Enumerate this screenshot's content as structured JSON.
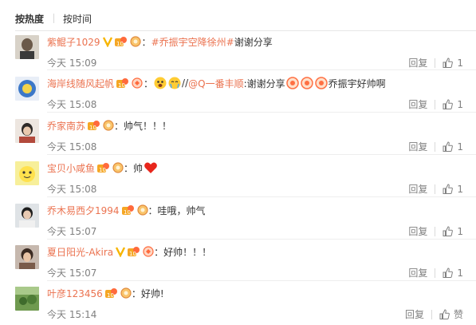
{
  "sort": {
    "hot": "按热度",
    "time": "按时间"
  },
  "reply_label": "回复",
  "comments": [
    {
      "user": "紫鲲子1029",
      "parts": [
        {
          "t": "topic",
          "v": "#乔振宇空降徐州#"
        },
        {
          "t": "text",
          "v": " 谢谢分享"
        }
      ],
      "time": "今天 15:09",
      "likes": "1"
    },
    {
      "user": "海岸线随风起帆",
      "parts": [
        {
          "t": "text",
          "v": "//"
        },
        {
          "t": "mention",
          "v": "@Q一番丰顺"
        },
        {
          "t": "text",
          "v": ":谢谢分享"
        },
        {
          "t": "text",
          "v": "乔振宇好帅啊"
        }
      ],
      "time": "今天 15:08",
      "likes": "1"
    },
    {
      "user": "乔家南苏",
      "parts": [
        {
          "t": "text",
          "v": "：帅气！！！"
        }
      ],
      "time": "今天 15:08",
      "likes": "1"
    },
    {
      "user": "宝贝小咸鱼",
      "parts": [
        {
          "t": "text",
          "v": "：帅"
        }
      ],
      "time": "今天 15:08",
      "likes": "1"
    },
    {
      "user": "乔木易西夕1994",
      "parts": [
        {
          "t": "text",
          "v": "：哇哦，帅气"
        }
      ],
      "time": "今天 15:07",
      "likes": "1"
    },
    {
      "user": "夏日阳光-Akira",
      "parts": [
        {
          "t": "text",
          "v": "：好帅！！！"
        }
      ],
      "time": "今天 15:07",
      "likes": "1"
    },
    {
      "user": "叶彦123456",
      "parts": [
        {
          "t": "text",
          "v": "：好帅!"
        }
      ],
      "time": "今天 15:14",
      "likes": "赞"
    }
  ],
  "colors": {
    "username": "#eb7350",
    "meta": "#808080",
    "verified": "#f7b500"
  },
  "icons": [
    "verified-icon",
    "fan-badge-icon",
    "member-badge-icon",
    "emoji-icon",
    "heart-emoji-icon",
    "thumb-up-icon"
  ]
}
